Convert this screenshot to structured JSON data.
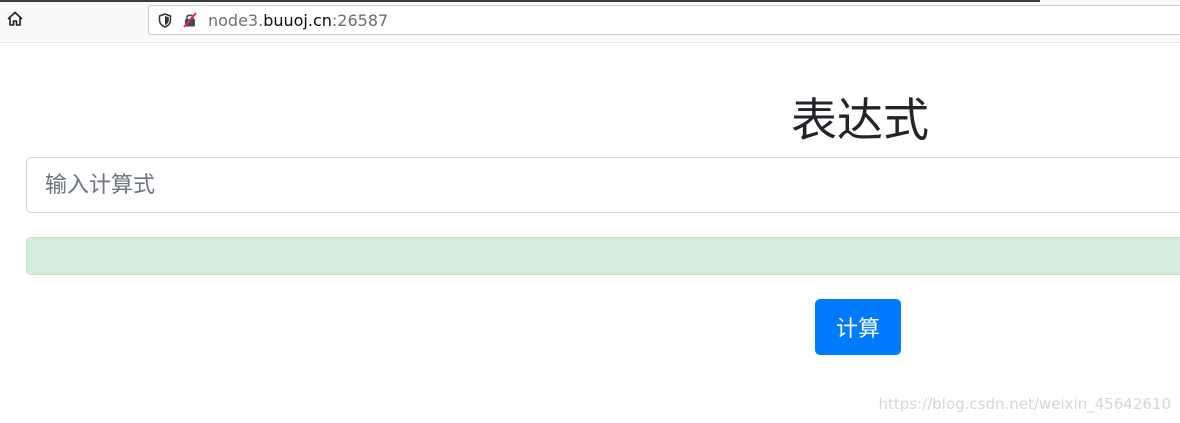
{
  "browser": {
    "url_prefix": "node3.",
    "url_domain": "buuoj.cn",
    "url_suffix": ":26587",
    "icons": {
      "home": "home-icon",
      "shield": "shield-icon",
      "insecure_lock": "insecure-lock-icon"
    }
  },
  "page": {
    "heading": "表达式",
    "input": {
      "placeholder": "输入计算式",
      "value": ""
    },
    "result": "",
    "calc_button": "计算"
  },
  "watermark": "https://blog.csdn.net/weixin_45642610",
  "colors": {
    "primary": "#007bff",
    "alert_bg": "#d4edda",
    "alert_border": "#c3e6cb",
    "heading": "#212529"
  }
}
